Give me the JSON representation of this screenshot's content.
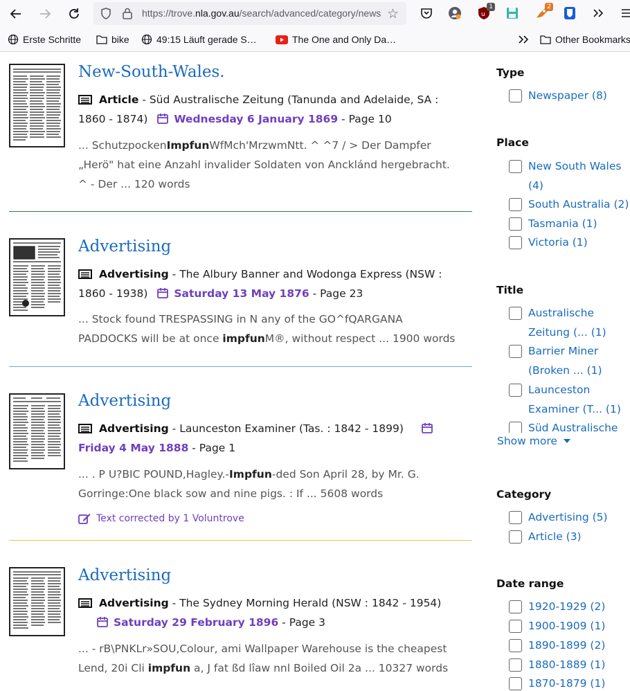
{
  "browser": {
    "url_prefix": "https://trove.",
    "url_host": "nla.gov.au",
    "url_rest": "/search/advanced/category/newspapers",
    "ext_badge_1": "1",
    "ext_badge_2": "2",
    "bookmarks": [
      {
        "label": "Erste Schritte",
        "icon": "globe-icon"
      },
      {
        "label": "bike",
        "icon": "folder-icon"
      },
      {
        "label": "49:15 Läuft gerade S…",
        "icon": "globe-icon"
      },
      {
        "label": "The One and Only Da…",
        "icon": "youtube-icon"
      }
    ],
    "other_bookmarks": "Other Bookmarks"
  },
  "results": [
    {
      "title": "New-South-Wales.",
      "type": "Article",
      "source_line1": " - Süd Australische Zeitung (Tanunda and Adelaide, SA :",
      "source_line2": "1860 - 1874)",
      "date": "Wednesday 6 January 1869",
      "page": " - Page 10",
      "snippet_a": "... Schutzpocken",
      "snippet_hl": "Impfun",
      "snippet_b": "WfMch'MrzwmNtt. ^ ^7 / > Der Dampfer „Herö\" hat eine Anzahl invalider Soldaten von Ancklánd hergebracht. ^ - Der ... 120 words",
      "divider_color": "#2e7d4f"
    },
    {
      "title": "Advertising",
      "type": "Advertising",
      "source_line1": " - The Albury Banner and Wodonga Express (NSW :",
      "source_line2": "1860 - 1938)",
      "date": "Saturday 13 May 1876",
      "page": " - Page 23",
      "snippet_a": "... Stock found TRESPASSING in N any of the GO^fQARGANA PADDOCKS will be at once ",
      "snippet_hl": "impfun",
      "snippet_b": "M®, without respect ... 1900 words",
      "divider_color": "#6aaad8"
    },
    {
      "title": "Advertising",
      "type": "Advertising",
      "source_line1": " - Launceston Examiner (Tas. : 1842 - 1899)",
      "date": "Friday 4 May 1888",
      "page": " - Page 1",
      "snippet_a": "... . P U?BIC POUND,Hagley.-",
      "snippet_hl": "Impfun",
      "snippet_b": "-ded Son April 28, by Mr. G. Gorringe:One black sow and nine pigs. : If ... 5608 words",
      "corrected": "Text corrected by 1 Voluntrove",
      "divider_color": "#d9cd4a"
    },
    {
      "title": "Advertising",
      "type": "Advertising",
      "source_line1": " - The Sydney Morning Herald (NSW : 1842 - 1954)",
      "date": "Saturday 29 February 1896",
      "page": " - Page 3",
      "snippet_a": "... - rB\\PNKLr»SOU,Colour, ami Wallpaper Warehouse is the cheapest Lend, 20i Cli ",
      "snippet_hl": "impfun",
      "snippet_b": " a, J fat ßd lîaw nnl Boiled Oil 2a ... 10327 words"
    }
  ],
  "facets": {
    "type": {
      "heading": "Type",
      "items": [
        "Newspaper (8)"
      ]
    },
    "place": {
      "heading": "Place",
      "items": [
        "New South Wales (4)",
        "South Australia (2)",
        "Tasmania (1)",
        "Victoria (1)"
      ]
    },
    "title": {
      "heading": "Title",
      "items": [
        "Australische Zeitung (... (1)",
        "Barrier Miner (Broken ... (1)",
        "Launceston Examiner (T... (1)",
        "Süd Australische"
      ],
      "show_more": "Show more"
    },
    "category": {
      "heading": "Category",
      "items": [
        "Advertising (5)",
        "Article (3)"
      ]
    },
    "date_range": {
      "heading": "Date range",
      "items": [
        "1920-1929 (2)",
        "1900-1909 (1)",
        "1890-1899 (2)",
        "1880-1889 (1)",
        "1870-1879 (1)"
      ]
    }
  },
  "colors": {
    "link": "#1a6bbf",
    "date": "#6f3fbf",
    "title_serif": "#1a6bbf"
  }
}
